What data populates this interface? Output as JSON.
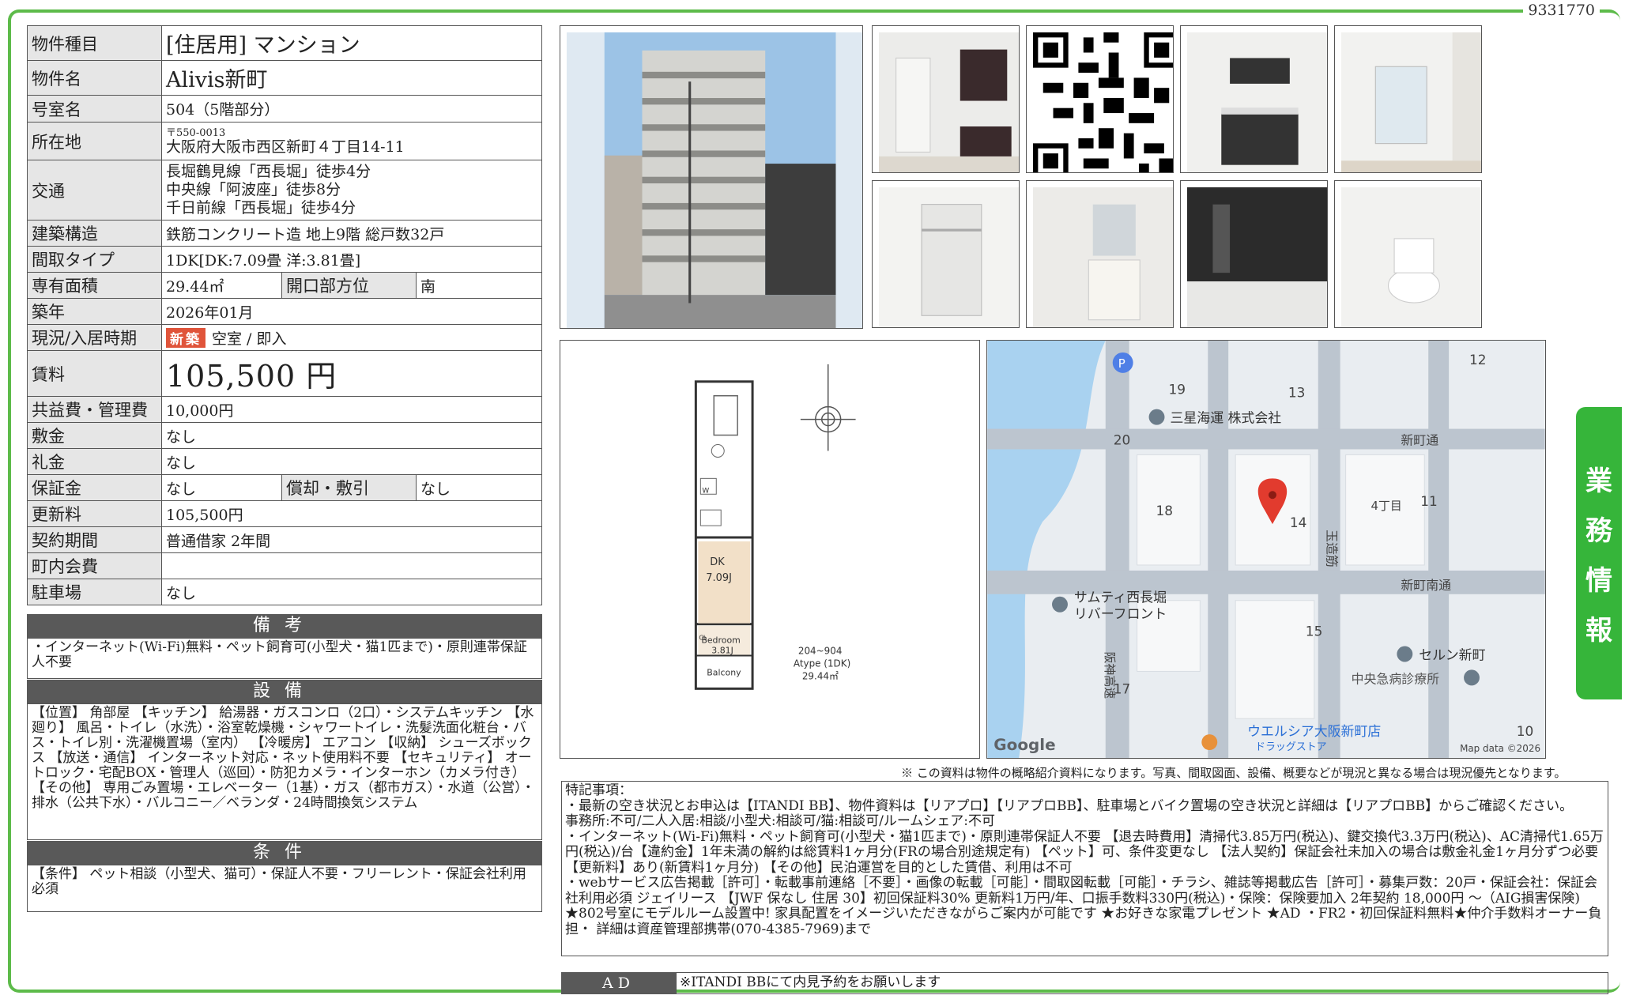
{
  "property_id": "9331770",
  "side_tab": [
    "業",
    "務",
    "情",
    "報"
  ],
  "spec": {
    "type_label": "物件種目",
    "type_value": "[住居用] マンション",
    "name_label": "物件名",
    "name_value": "Alivis新町",
    "room_label": "号室名",
    "room_value": "504（5階部分）",
    "address_label": "所在地",
    "postal": "〒550-0013",
    "address": "大阪府大阪市西区新町４丁目14-11",
    "access_label": "交通",
    "access": [
      "長堀鶴見線「西長堀」徒歩4分",
      "中央線「阿波座」徒歩8分",
      "千日前線「西長堀」徒歩4分"
    ],
    "structure_label": "建築構造",
    "structure_value": "鉄筋コンクリート造 地上9階 総戸数32戸",
    "layout_label": "間取タイプ",
    "layout_value": "1DK[DK:7.09畳 洋:3.81畳]",
    "area_label": "専有面積",
    "area_value": "29.44㎡",
    "direction_label": "開口部方位",
    "direction_value": "南",
    "built_label": "築年",
    "built_value": "2026年01月",
    "status_label": "現況/入居時期",
    "status_badge": "新築",
    "status_value": "空室 / 即入",
    "rent_label": "賃料",
    "rent_value": "105,500 円",
    "fee_label": "共益費・管理費",
    "fee_value": "10,000円",
    "deposit_label": "敷金",
    "deposit_value": "なし",
    "keymoney_label": "礼金",
    "keymoney_value": "なし",
    "guarantee_label": "保証金",
    "guarantee_value": "なし",
    "amort_label": "償却・敷引",
    "amort_value": "なし",
    "renewal_label": "更新料",
    "renewal_value": "105,500円",
    "contract_label": "契約期間",
    "contract_value": "普通借家 2年間",
    "town_label": "町内会費",
    "town_value": "",
    "parking_label": "駐車場",
    "parking_value": "なし"
  },
  "remarks_head": "備考",
  "remarks_body": "・インターネット(Wi-Fi)無料・ペット飼育可(小型犬・猫1匹まで)・原則連帯保証人不要",
  "equip_head": "設備",
  "equip_body": "【位置】 角部屋 【キッチン】 給湯器・ガスコンロ（2口）・システムキッチン 【水廻り】 風呂・トイレ（水洗）・浴室乾燥機・シャワートイレ・洗髪洗面化粧台・バス・トイレ別・洗濯機置場（室内） 【冷暖房】 エアコン 【収納】 シューズボックス 【放送・通信】 インターネット対応・ネット使用料不要 【セキュリティ】 オートロック・宅配BOX・管理人（巡回）・防犯カメラ・インターホン（カメラ付き） 【その他】 専用ごみ置場・エレベーター（1基）・ガス（都市ガス）・水道（公営）・排水（公共下水）・バルコニー／ベランダ・24時間換気システム",
  "cond_head": "条件",
  "cond_body": "【条件】 ペット相談（小型犬、猫可）・保証人不要・フリーレント・保証会社利用必須",
  "floorplan": {
    "dk": "DK",
    "dk_size": "7.09J",
    "bed": "Bedroom",
    "bed_size": "3.81J",
    "balcony": "Balcony",
    "w": "W",
    "cl": "CL",
    "range": "204~904",
    "type": "Atype (1DK)",
    "area": "29.44㎡"
  },
  "map": {
    "blocks": [
      "19",
      "13",
      "12",
      "20",
      "18",
      "14",
      "11",
      "15",
      "17",
      "10"
    ],
    "poi_1": "三星海運 株式会社",
    "poi_2": "サムティ西長堀",
    "poi_2b": "リバーフロント",
    "poi_3": "セルン新町",
    "poi_4": "中央急病診療所",
    "poi_5": "ウエルシア大阪新町店",
    "poi_5b": "ドラッグストア",
    "street_1": "新町通",
    "street_2": "新町南通",
    "street_3": "4丁目",
    "street_4": "玉造筋",
    "street_5": "阪神高速",
    "google": "Google",
    "mapdata": "Map data ©2026"
  },
  "disclaimer": "※ この資料は物件の概略紹介資料になります。写真、間取図面、設備、概要などが現況と異なる場合は現況優先となります。",
  "special_notes": "特記事項：\n・最新の空き状況とお申込は【ITANDI BB】、物件資料は【リアプロ】【リアプロBB】、駐車場とバイク置場の空き状況と詳細は【リアプロBB】からご確認ください。\n事務所:不可/二人入居:相談/小型犬:相談可/猫:相談可/ルームシェア:不可\n・インターネット(Wi-Fi)無料・ペット飼育可(小型犬・猫1匹まで)・原則連帯保証人不要 【退去時費用】清掃代3.85万円(税込)、鍵交換代3.3万円(税込)、AC清掃代1.65万円(税込)/台【違約金】1年未満の解約は総賃料1ヶ月分(FRの場合別途規定有) 【ペット】可、条件変更なし 【法人契約】保証会社未加入の場合は敷金礼金1ヶ月分ずつ必要 【更新料】あり(新賃料1ヶ月分) 【その他】民泊運営を目的とした賃借、利用は不可\n・webサービス広告掲載［許可］・転載事前連絡［不要］・画像の転載［可能］・間取図転載［可能］・チラシ、雑誌等掲載広告［許可］・募集戸数：20戸・保証会社：保証会社利用必須 ジェイリース 【JWF 保なし 住居 30】初回保証料30% 更新料1万円/年、口振手数料330円(税込)・保険：保険要加入 2年契約 18,000円 〜（AIG損害保険)\n★802号室にモデルルーム設置中! 家具配置をイメージいただきながらご案内が可能です ★お好きな家電プレゼント ★AD ・FR2・初回保証料無料★仲介手数料オーナー負担・ 詳細は資産管理部携帯(070-4385-7969)まで",
  "ad_label": "AD",
  "ad_value": "※ITANDI BBにて内見予約をお願いします",
  "colors": {
    "accent_green": "#5dbb4a",
    "tab_green": "#36b53a",
    "header_gray": "#595959",
    "badge_red": "#e0543a"
  }
}
